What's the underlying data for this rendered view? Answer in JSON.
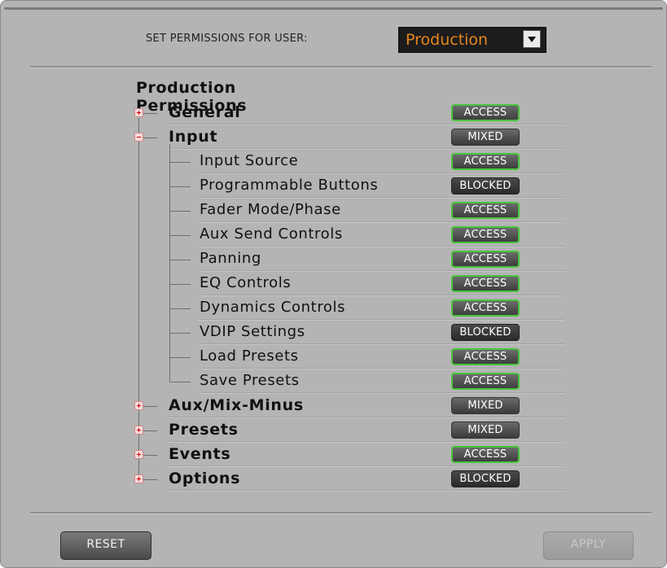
{
  "header": {
    "label": "SET PERMISSIONS FOR USER:",
    "selected_user": "Production"
  },
  "tree": {
    "title": "Production Permissions",
    "groups": [
      {
        "label": "General",
        "state": "ACCESS",
        "expanded": false
      },
      {
        "label": "Input",
        "state": "MIXED",
        "expanded": true,
        "children": [
          {
            "label": "Input Source",
            "state": "ACCESS"
          },
          {
            "label": "Programmable Buttons",
            "state": "BLOCKED"
          },
          {
            "label": "Fader Mode/Phase",
            "state": "ACCESS"
          },
          {
            "label": "Aux Send Controls",
            "state": "ACCESS"
          },
          {
            "label": "Panning",
            "state": "ACCESS"
          },
          {
            "label": "EQ Controls",
            "state": "ACCESS"
          },
          {
            "label": "Dynamics Controls",
            "state": "ACCESS"
          },
          {
            "label": "VDIP Settings",
            "state": "BLOCKED"
          },
          {
            "label": "Load Presets",
            "state": "ACCESS"
          },
          {
            "label": "Save Presets",
            "state": "ACCESS"
          }
        ]
      },
      {
        "label": "Aux/Mix-Minus",
        "state": "MIXED",
        "expanded": false
      },
      {
        "label": "Presets",
        "state": "MIXED",
        "expanded": false
      },
      {
        "label": "Events",
        "state": "ACCESS",
        "expanded": false
      },
      {
        "label": "Options",
        "state": "BLOCKED",
        "expanded": false
      }
    ]
  },
  "footer": {
    "reset_label": "RESET",
    "apply_label": "APPLY"
  },
  "colors": {
    "access_border": "#49c43b",
    "user_value": "#e8861e"
  }
}
